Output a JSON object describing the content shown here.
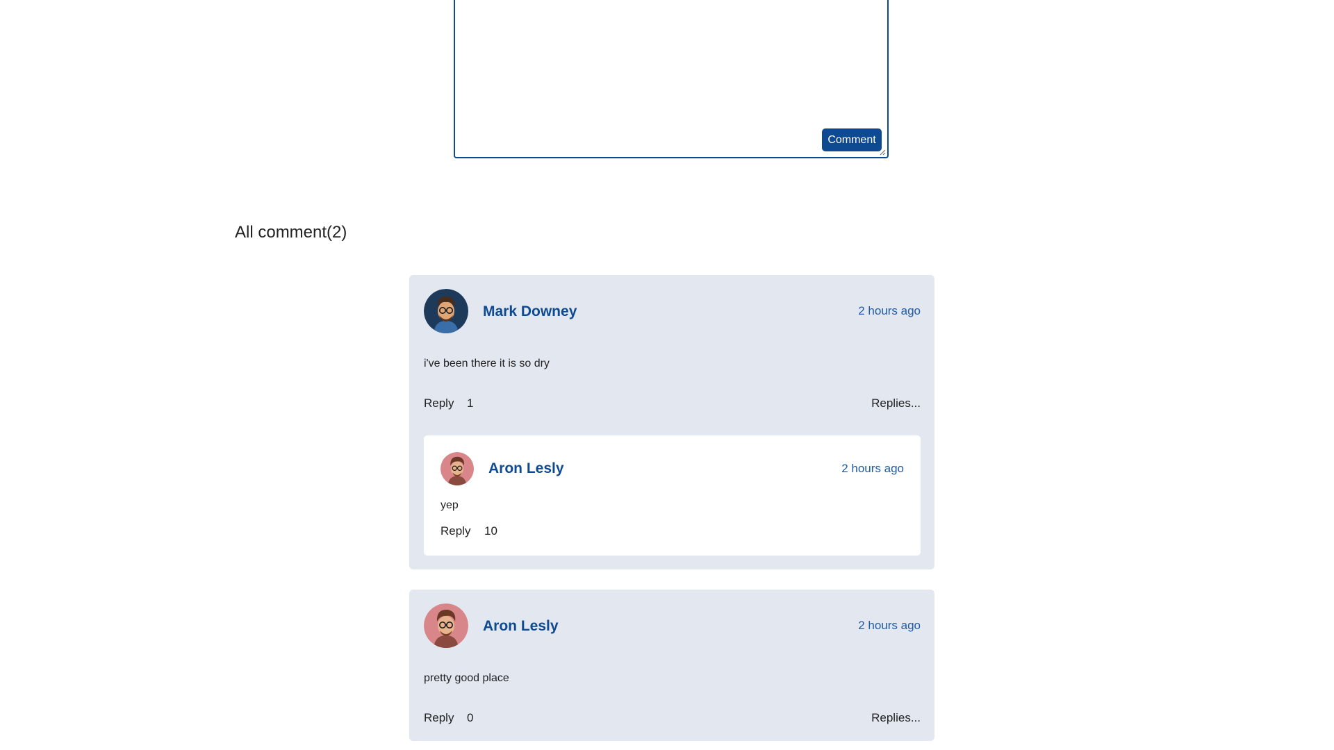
{
  "composer": {
    "value": "",
    "placeholder": "",
    "button_label": "Comment"
  },
  "comments_section": {
    "title": "All comment(2)"
  },
  "comments": [
    {
      "author": "Mark Downey",
      "time": "2 hours ago",
      "text": "i've been there it is so dry",
      "reply_label": "Reply",
      "count": "1",
      "replies_label": "Replies...",
      "avatar_color": "#1e3a5a",
      "replies": [
        {
          "author": "Aron Lesly",
          "time": "2 hours ago",
          "text": "yep",
          "reply_label": "Reply",
          "count": "10",
          "avatar_color": "#d9868a"
        }
      ]
    },
    {
      "author": "Aron Lesly",
      "time": "2 hours ago",
      "text": "pretty good place",
      "reply_label": "Reply",
      "count": "0",
      "replies_label": "Replies...",
      "avatar_color": "#d9868a"
    }
  ],
  "colors": {
    "accent": "#0d4a91",
    "card_background": "#e2e7f0",
    "time_text": "#1f5aa6"
  }
}
